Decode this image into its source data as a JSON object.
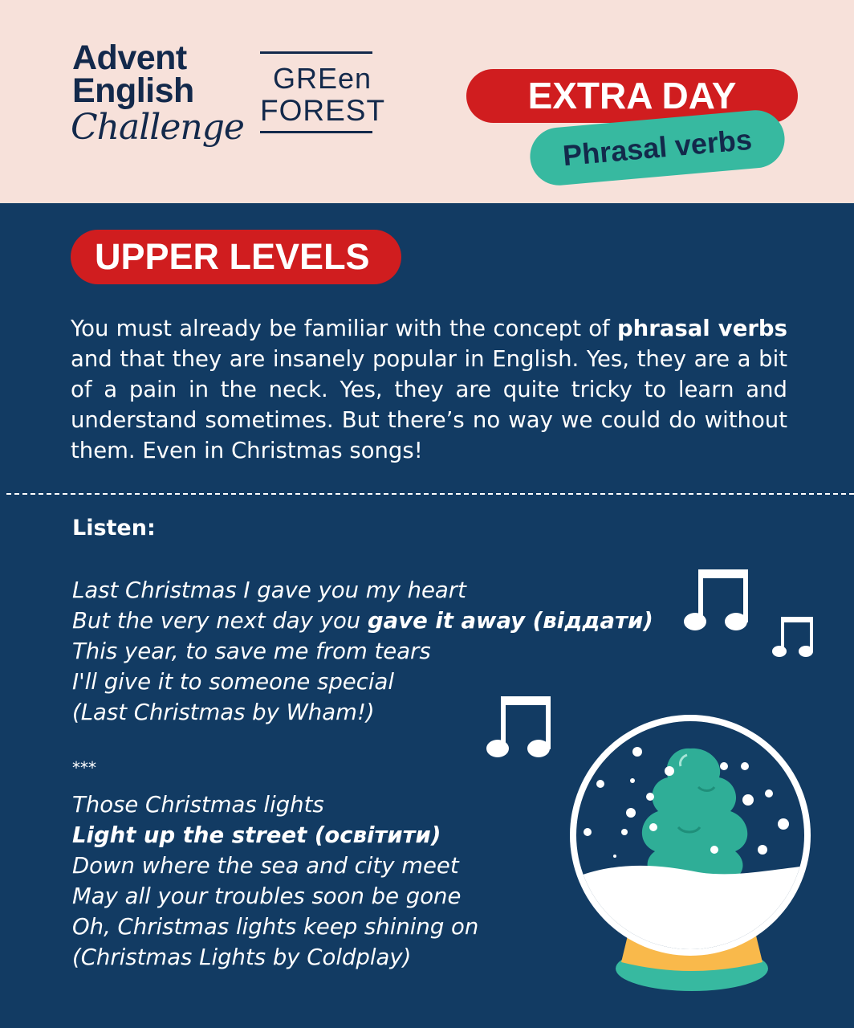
{
  "header": {
    "logo_line1": "Advent",
    "logo_line2": "English",
    "logo_line3": "Challenge",
    "brand_line1": "GREen",
    "brand_line2": "FOREST",
    "badge_day": "EXTRA DAY",
    "badge_topic": "Phrasal verbs"
  },
  "section": {
    "level": "UPPER LEVELS",
    "intro_part1": "You must already be familiar with the concept of ",
    "intro_bold": "phrasal verbs",
    "intro_part2": " and that they are insanely popular in English. Yes, they are a bit of a pain in the neck. Yes, they are quite tricky to learn and understand sometimes. But there’s no way we could do without them. Even in Christmas songs!"
  },
  "listen_label": "Listen:",
  "song1": {
    "line1": "Last Christmas I gave you my heart",
    "line2_pre": "But the very next day you ",
    "line2_bold": "gave it away (віддати)",
    "line3": "This year, to save me from tears",
    "line4": "I'll give it to someone special",
    "credit": "(Last Christmas by Wham!)"
  },
  "separator": "***",
  "song2": {
    "line1": "Those Christmas lights",
    "line2_bold": "Light up the street (освітити)",
    "line3": "Down where the sea and city meet",
    "line4": "May all your troubles soon be gone",
    "line5": "Oh, Christmas lights keep shining on",
    "credit": "(Christmas Lights by Coldplay)"
  },
  "colors": {
    "background": "#123b63",
    "header_bg": "#f7e1da",
    "accent_red": "#d01d1f",
    "accent_teal": "#37b9a0",
    "navy_text": "#13294b",
    "globe_base": "#f9b94b"
  },
  "icons": [
    "music-note-icon",
    "snow-globe-icon"
  ]
}
